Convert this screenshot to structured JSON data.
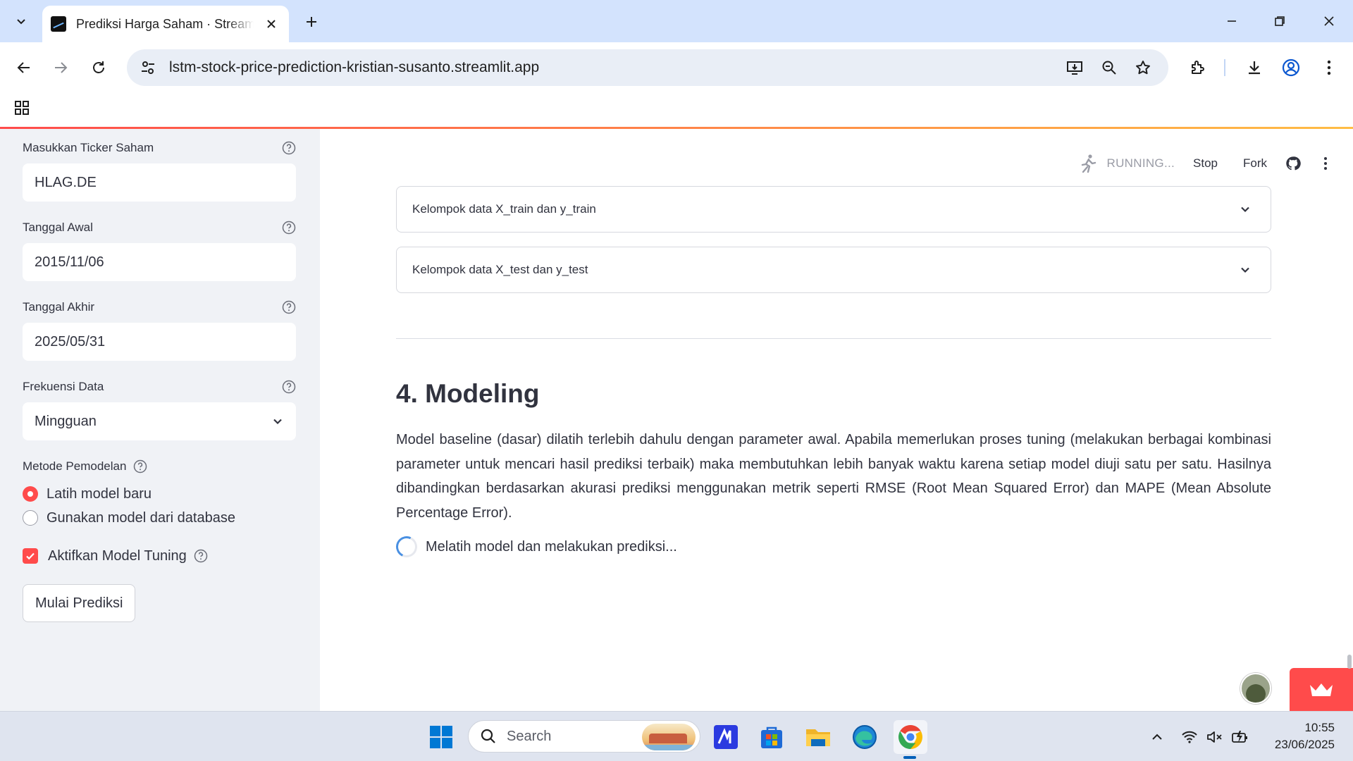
{
  "browser": {
    "tab_title": "Prediksi Harga Saham · Streamlit",
    "url": "lstm-stock-price-prediction-kristian-susanto.streamlit.app"
  },
  "sidebar": {
    "ticker": {
      "label": "Masukkan Ticker Saham",
      "value": "HLAG.DE"
    },
    "start_date": {
      "label": "Tanggal Awal",
      "value": "2015/11/06"
    },
    "end_date": {
      "label": "Tanggal Akhir",
      "value": "2025/05/31"
    },
    "frequency": {
      "label": "Frekuensi Data",
      "selected": "Mingguan"
    },
    "method": {
      "label": "Metode Pemodelan",
      "options": [
        "Latih model baru",
        "Gunakan model dari database"
      ],
      "selected_index": 0
    },
    "tuning": {
      "label": "Aktifkan Model Tuning",
      "checked": true
    },
    "predict_button": "Mulai Prediksi"
  },
  "main": {
    "status": {
      "running": "RUNNING...",
      "stop": "Stop",
      "fork": "Fork"
    },
    "expanders": [
      "Kelompok data X_train dan y_train",
      "Kelompok data X_test dan y_test"
    ],
    "heading": "4. Modeling",
    "paragraph": "Model baseline (dasar) dilatih terlebih dahulu dengan parameter awal. Apabila memerlukan proses tuning (melakukan berbagai kombinasi parameter untuk mencari hasil prediksi terbaik) maka membutuhkan lebih banyak waktu karena setiap model diuji satu per satu. Hasilnya dibandingkan berdasarkan akurasi prediksi menggunakan metrik seperti RMSE (Root Mean Squared Error) dan MAPE (Mean Absolute Percentage Error).",
    "spinner_text": "Melatih model dan melakukan prediksi..."
  },
  "taskbar": {
    "search_placeholder": "Search",
    "time": "10:55",
    "date": "23/06/2025"
  },
  "colors": {
    "accent": "#ff4b4b",
    "sidebar_bg": "#f0f2f6",
    "tabstrip_bg": "#d3e3fd",
    "spinner": "#4a90e2"
  }
}
